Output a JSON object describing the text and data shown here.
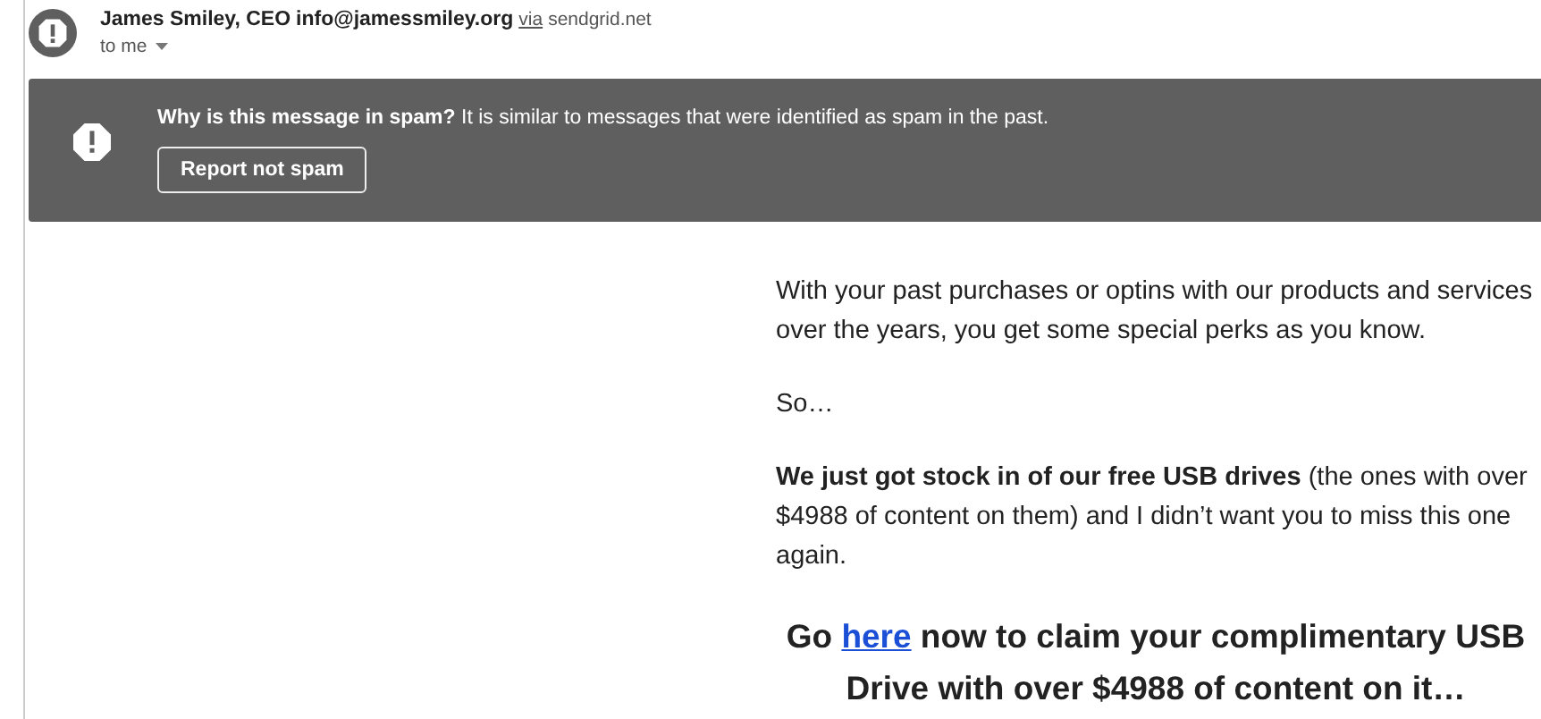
{
  "sender": {
    "name": "James Smiley, CEO",
    "email": "info@jamessmiley.org",
    "via": "via",
    "domain": "sendgrid.net",
    "recipient": "to me"
  },
  "spam_banner": {
    "message": "**Why is this message in spam?** It is similar to messages that were identified as spam in the past.",
    "button": "Report not spam"
  },
  "body": [
    {
      "kind": "paragraph",
      "text": "With your past purchases or optins with our products and services over the years, you get some special perks as you know."
    },
    {
      "kind": "paragraph",
      "text": "So…"
    },
    {
      "kind": "paragraph",
      "text": "**We just got stock in of our free USB drives** (the ones with over $4988 of content on them) and I didn’t want you to miss this one again."
    },
    {
      "kind": "headline",
      "before": "Go ",
      "link": "here",
      "after": " now to claim your complimentary USB Drive with over $4988 of content on it…"
    }
  ]
}
